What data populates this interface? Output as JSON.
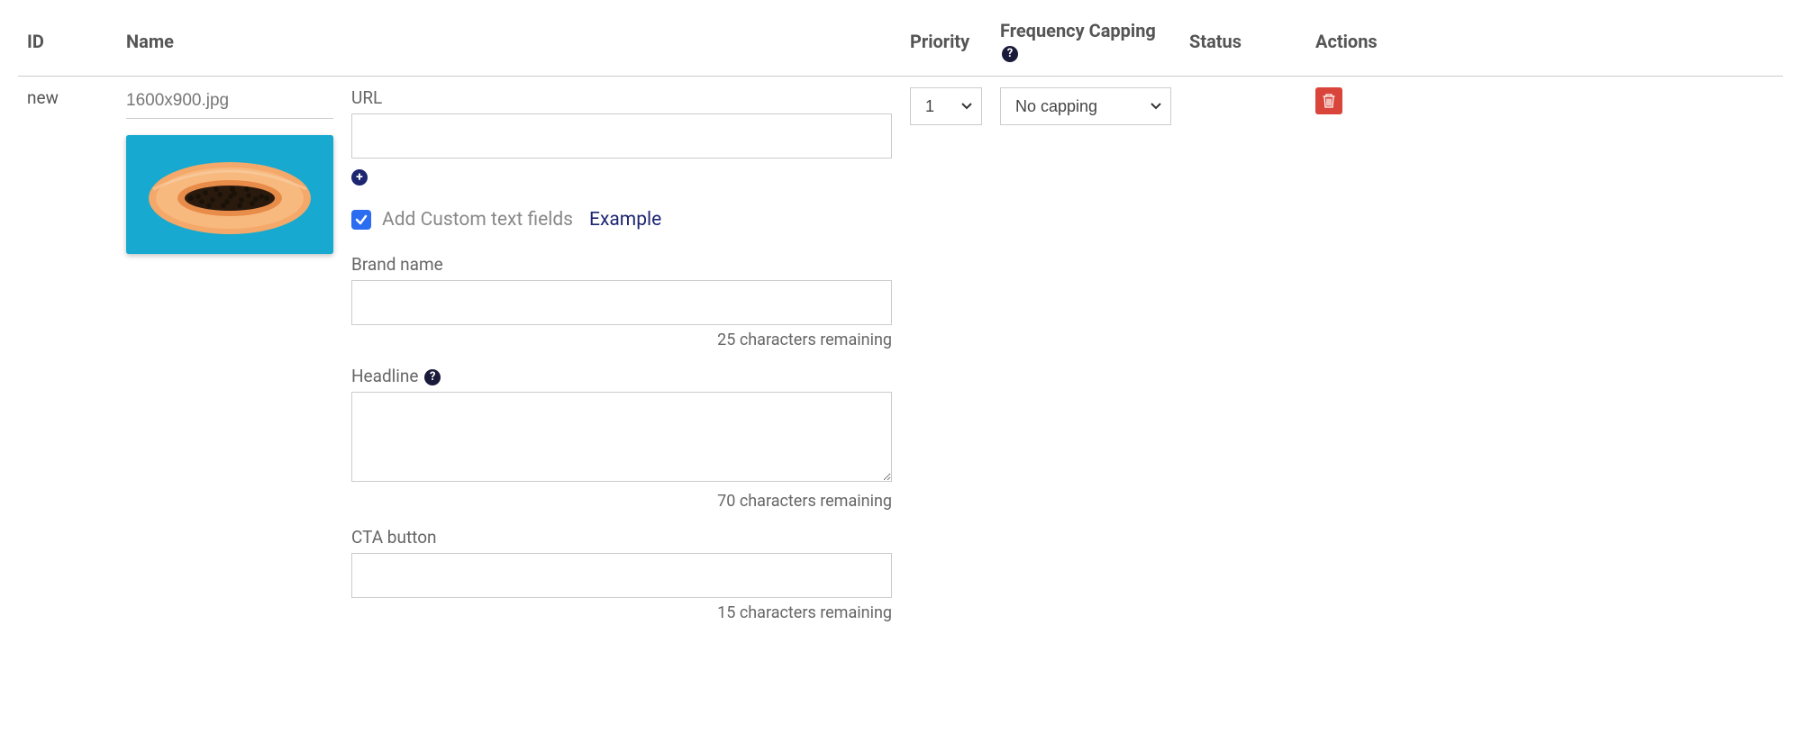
{
  "columns": {
    "id": "ID",
    "name": "Name",
    "priority": "Priority",
    "frequency": "Frequency Capping",
    "status": "Status",
    "actions": "Actions"
  },
  "row": {
    "id": "new",
    "name_value": "1600x900.jpg",
    "priority_selected": "1",
    "frequency_selected": "No capping"
  },
  "form": {
    "url_label": "URL",
    "add_custom_label": "Add Custom text fields",
    "example_link": "Example",
    "brand_label": "Brand name",
    "brand_counter": "25 characters remaining",
    "headline_label": "Headline",
    "headline_counter": "70 characters remaining",
    "cta_label": "CTA button",
    "cta_counter": "15 characters remaining"
  },
  "icons": {
    "plus": "+",
    "help": "?"
  }
}
